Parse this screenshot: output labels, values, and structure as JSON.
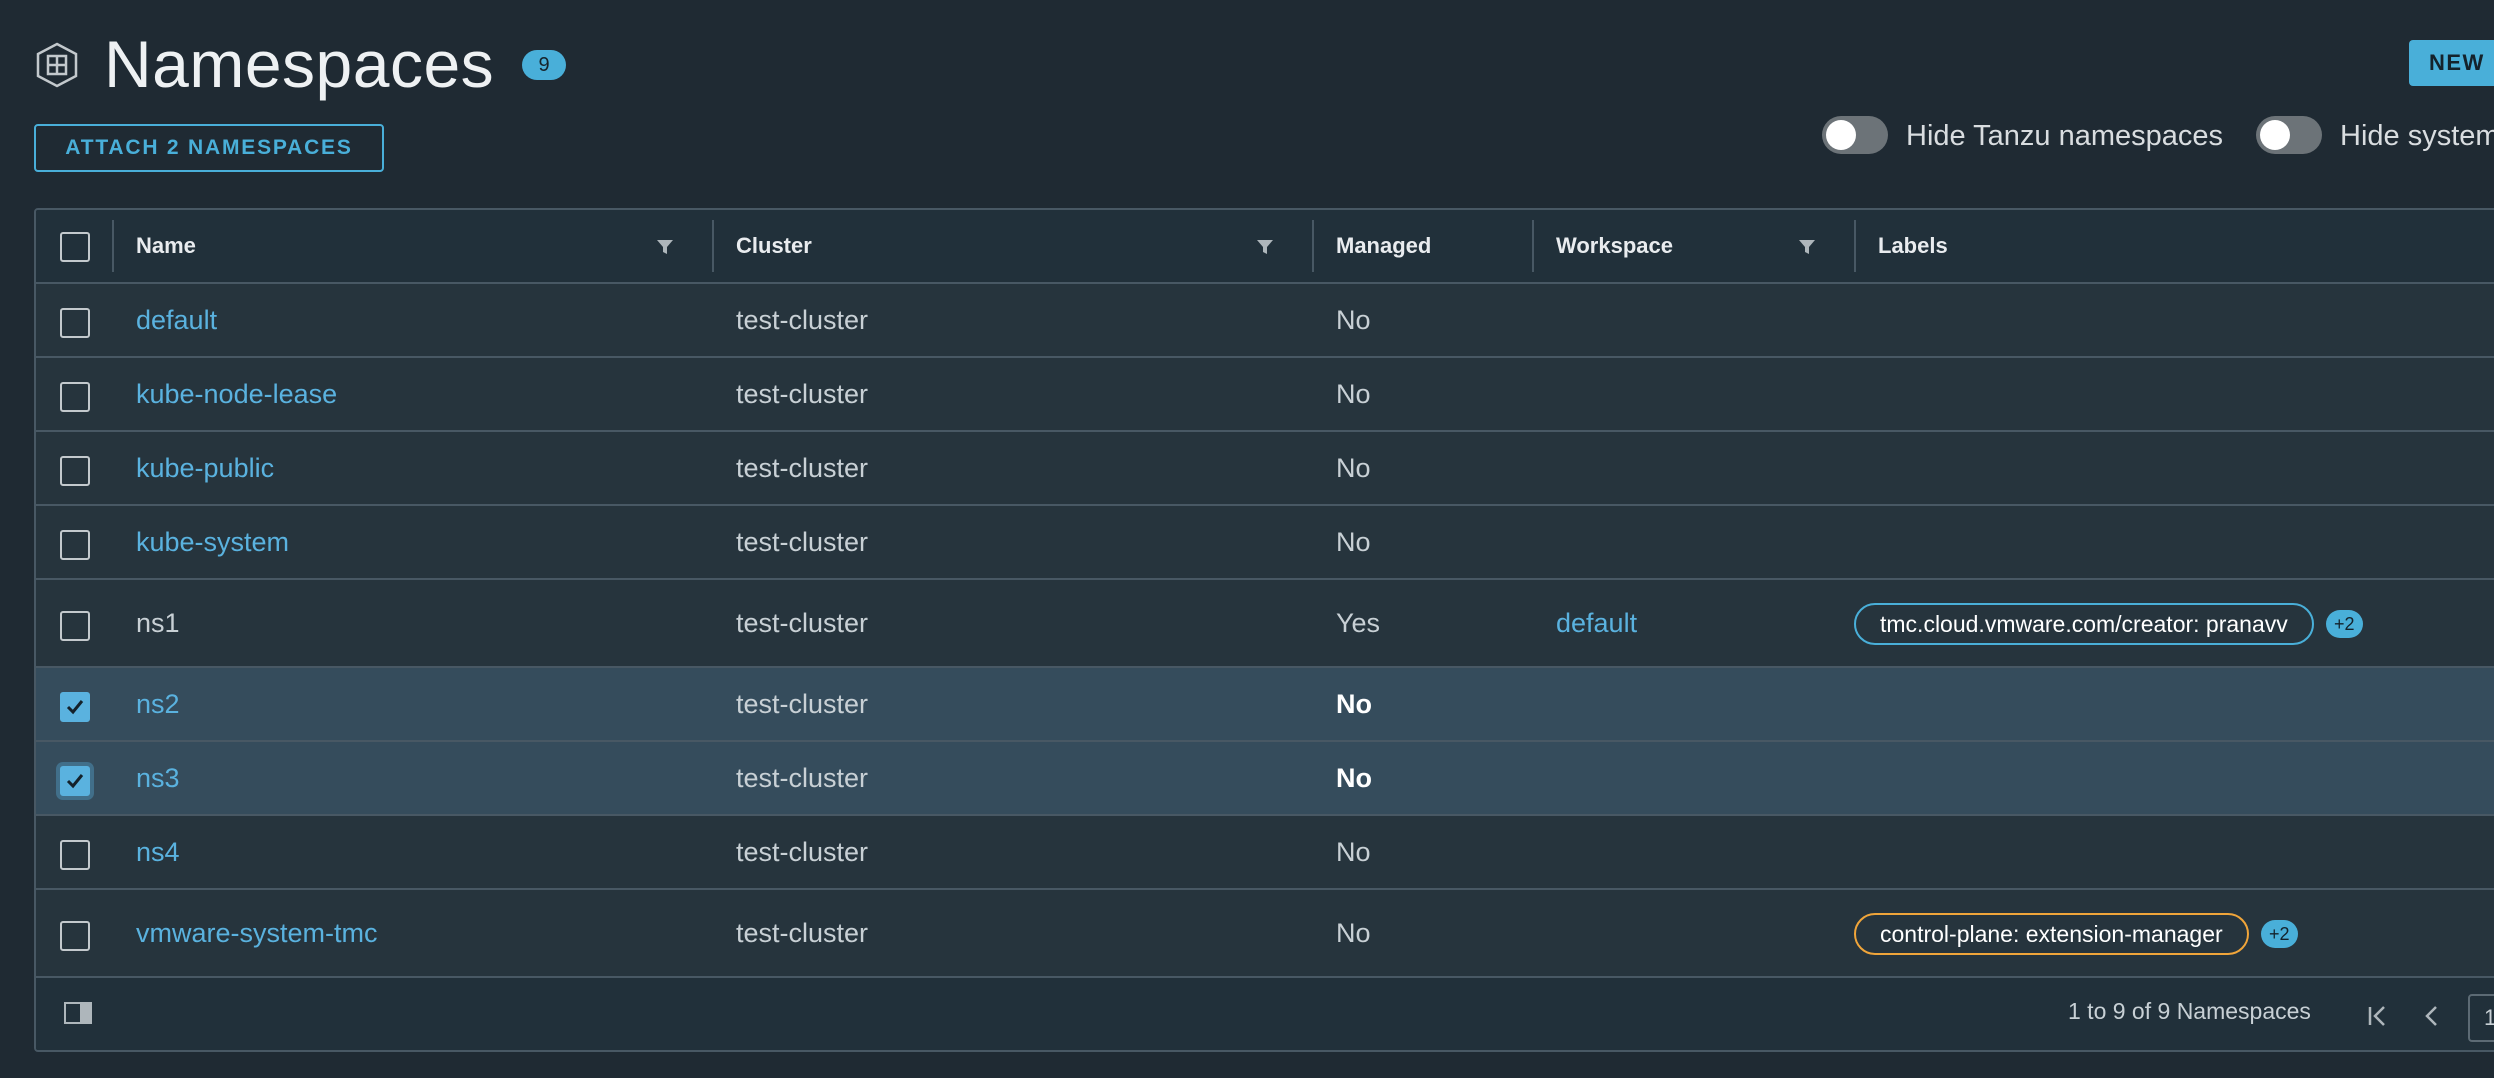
{
  "header": {
    "title": "Namespaces",
    "count": "9",
    "new_label": "NEW",
    "icon": "namespace-grid-icon"
  },
  "toolbar": {
    "attach_label": "ATTACH 2 NAMESPACES",
    "toggles": [
      {
        "label": "Hide Tanzu namespaces",
        "on": false
      },
      {
        "label": "Hide system namespaces",
        "on": false
      }
    ]
  },
  "grid": {
    "columns": [
      {
        "label": "Name",
        "filterable": true
      },
      {
        "label": "Cluster",
        "filterable": true
      },
      {
        "label": "Managed",
        "filterable": false
      },
      {
        "label": "Workspace",
        "filterable": true
      },
      {
        "label": "Labels",
        "filterable": false
      }
    ],
    "rows": [
      {
        "name": "default",
        "cluster": "test-cluster",
        "managed": "No",
        "workspace": "",
        "label": "",
        "more": "",
        "selected": false,
        "name_link": true
      },
      {
        "name": "kube-node-lease",
        "cluster": "test-cluster",
        "managed": "No",
        "workspace": "",
        "label": "",
        "more": "",
        "selected": false,
        "name_link": true
      },
      {
        "name": "kube-public",
        "cluster": "test-cluster",
        "managed": "No",
        "workspace": "",
        "label": "",
        "more": "",
        "selected": false,
        "name_link": true
      },
      {
        "name": "kube-system",
        "cluster": "test-cluster",
        "managed": "No",
        "workspace": "",
        "label": "",
        "more": "",
        "selected": false,
        "name_link": true
      },
      {
        "name": "ns1",
        "cluster": "test-cluster",
        "managed": "Yes",
        "workspace": "default",
        "label": "tmc.cloud.vmware.com/creator: pranavv",
        "more": "+2",
        "selected": false,
        "name_link": false
      },
      {
        "name": "ns2",
        "cluster": "test-cluster",
        "managed": "No",
        "workspace": "",
        "label": "",
        "more": "",
        "selected": true,
        "name_link": true
      },
      {
        "name": "ns3",
        "cluster": "test-cluster",
        "managed": "No",
        "workspace": "",
        "label": "",
        "more": "",
        "selected": true,
        "name_link": true
      },
      {
        "name": "ns4",
        "cluster": "test-cluster",
        "managed": "No",
        "workspace": "",
        "label": "",
        "more": "",
        "selected": false,
        "name_link": true
      },
      {
        "name": "vmware-system-tmc",
        "cluster": "test-cluster",
        "managed": "No",
        "workspace": "",
        "label": "control-plane: extension-manager",
        "more": "+2",
        "selected": false,
        "name_link": true
      }
    ],
    "footer": {
      "summary": "1 to 9 of 9 Namespaces",
      "page": "1"
    }
  },
  "colors": {
    "background": "#1f2a33",
    "accent": "#49afd9",
    "selected_row": "#354c5c",
    "label_orange": "#f0a53a"
  }
}
